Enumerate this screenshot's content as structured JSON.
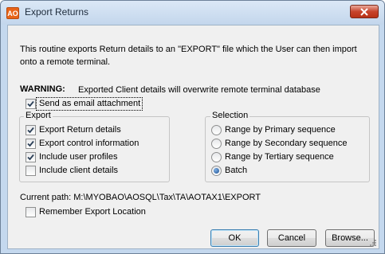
{
  "window": {
    "title": "Export Returns",
    "app_icon": "AO"
  },
  "intro": {
    "line1": "This routine exports Return details to an \"EXPORT\" file which the User can then import",
    "line2": "onto a remote terminal."
  },
  "warning": {
    "label": "WARNING:",
    "text": "Exported Client details will overwrite remote terminal database"
  },
  "email_attachment": {
    "label": "Send as email attachment",
    "checked": true
  },
  "export_group": {
    "title": "Export",
    "items": [
      {
        "label": "Export Return details",
        "checked": true
      },
      {
        "label": "Export control information",
        "checked": true
      },
      {
        "label": "Include user profiles",
        "checked": true
      },
      {
        "label": "Include client details",
        "checked": false
      }
    ]
  },
  "selection_group": {
    "title": "Selection",
    "options": [
      {
        "label": "Range by Primary sequence",
        "selected": false
      },
      {
        "label": "Range by Secondary sequence",
        "selected": false
      },
      {
        "label": "Range by Tertiary sequence",
        "selected": false
      },
      {
        "label": "Batch",
        "selected": true
      }
    ]
  },
  "current_path": "Current path: M:\\MYOBAO\\AOSQL\\Tax\\TA\\AOTAX1\\EXPORT",
  "remember_location": {
    "label": "Remember Export Location",
    "checked": false
  },
  "buttons": {
    "ok": "OK",
    "cancel": "Cancel",
    "browse": "Browse..."
  },
  "colors": {
    "titlebar": "#c4d8ee",
    "dialog_bg": "#f0f0f0",
    "close_button": "#c7442c",
    "radio_dot": "#1c4f8e"
  }
}
